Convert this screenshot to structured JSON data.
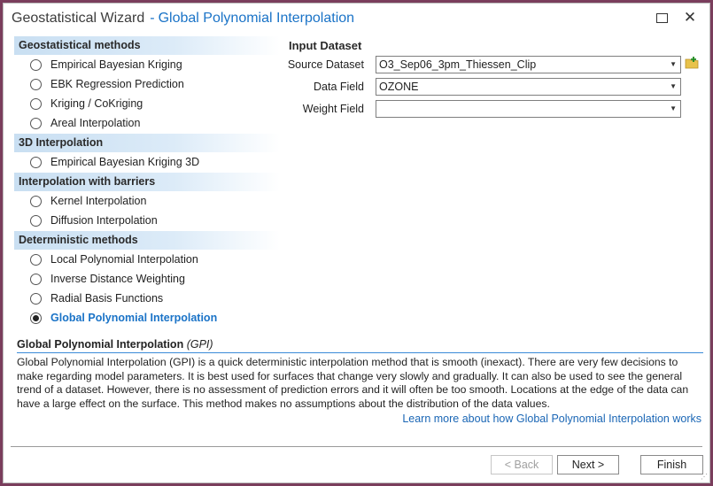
{
  "window": {
    "title": "Geostatistical Wizard",
    "separator": "-",
    "subtitle": "Global Polynomial Interpolation"
  },
  "methods": {
    "groups": [
      {
        "header": "Geostatistical methods",
        "items": [
          {
            "label": "Empirical Bayesian Kriging",
            "selected": false
          },
          {
            "label": "EBK Regression Prediction",
            "selected": false
          },
          {
            "label": "Kriging / CoKriging",
            "selected": false
          },
          {
            "label": "Areal Interpolation",
            "selected": false
          }
        ]
      },
      {
        "header": "3D Interpolation",
        "items": [
          {
            "label": "Empirical Bayesian Kriging 3D",
            "selected": false
          }
        ]
      },
      {
        "header": "Interpolation with barriers",
        "items": [
          {
            "label": "Kernel Interpolation",
            "selected": false
          },
          {
            "label": "Diffusion Interpolation",
            "selected": false
          }
        ]
      },
      {
        "header": "Deterministic methods",
        "items": [
          {
            "label": "Local Polynomial Interpolation",
            "selected": false
          },
          {
            "label": "Inverse Distance Weighting",
            "selected": false
          },
          {
            "label": "Radial Basis Functions",
            "selected": false
          },
          {
            "label": "Global Polynomial Interpolation",
            "selected": true
          }
        ]
      }
    ]
  },
  "input": {
    "title": "Input Dataset",
    "source_label": "Source Dataset",
    "source_value": "O3_Sep06_3pm_Thiessen_Clip",
    "field_label": "Data Field",
    "field_value": "OZONE",
    "weight_label": "Weight Field",
    "weight_value": ""
  },
  "description": {
    "title": "Global Polynomial Interpolation",
    "abbr": "(GPI)",
    "text": "Global Polynomial Interpolation (GPI) is a quick deterministic interpolation method that is smooth (inexact). There are very few decisions to make regarding model parameters. It is best used for surfaces that change very slowly and gradually. It can also be used to see the general trend of a dataset. However, there is no assessment of prediction errors and it will often be too smooth. Locations at the edge of the data can have a large effect on the surface. This method makes no assumptions about the distribution of the data values.",
    "link": "Learn more about how Global Polynomial Interpolation works"
  },
  "buttons": {
    "back": "< Back",
    "next": "Next >",
    "finish": "Finish"
  },
  "colors": {
    "accent": "#1a73c7",
    "header_bg": "#c9dff2",
    "folder_icon": "#e8c24a"
  }
}
